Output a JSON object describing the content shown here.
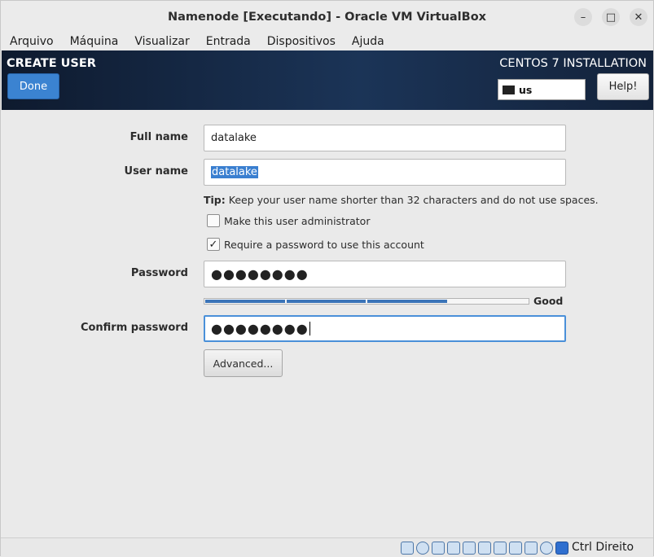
{
  "window": {
    "title": "Namenode [Executando] - Oracle VM VirtualBox",
    "controls": {
      "minimize": "–",
      "maximize": "□",
      "close": "✕"
    }
  },
  "menu": [
    "Arquivo",
    "Máquina",
    "Visualizar",
    "Entrada",
    "Dispositivos",
    "Ajuda"
  ],
  "header": {
    "title": "CREATE USER",
    "installation": "CENTOS 7 INSTALLATION",
    "done_label": "Done",
    "help_label": "Help!",
    "keyboard_layout": "us",
    "keyboard_icon": "keyboard-icon"
  },
  "form": {
    "full_name_label": "Full name",
    "full_name_value": "datalake",
    "user_name_label": "User name",
    "user_name_value": "datalake",
    "tip_prefix": "Tip:",
    "tip_text": " Keep your user name shorter than 32 characters and do not use spaces.",
    "admin_label": "Make this user administrator",
    "admin_checked": false,
    "require_password_label": "Require a password to use this account",
    "require_password_checked": true,
    "check_mark": "✓",
    "password_label": "Password",
    "password_value": "●●●●●●●●",
    "strength_fraction": 0.75,
    "strength_label": "Good",
    "confirm_label": "Confirm password",
    "confirm_value": "●●●●●●●●",
    "advanced_label": "Advanced..."
  },
  "statusbar": {
    "icons": [
      "hard-disk-icon",
      "optical-drive-icon",
      "audio-icon",
      "network-icon",
      "usb-icon",
      "shared-folders-icon",
      "display-icon",
      "video-capture-icon",
      "virtualization-icon",
      "mouse-integration-icon",
      "keyboard-capture-icon"
    ],
    "host_key": "Ctrl Direito"
  },
  "colors": {
    "accent": "#3b83d1",
    "header": "#1b3457",
    "meter": "#3b74b8"
  }
}
